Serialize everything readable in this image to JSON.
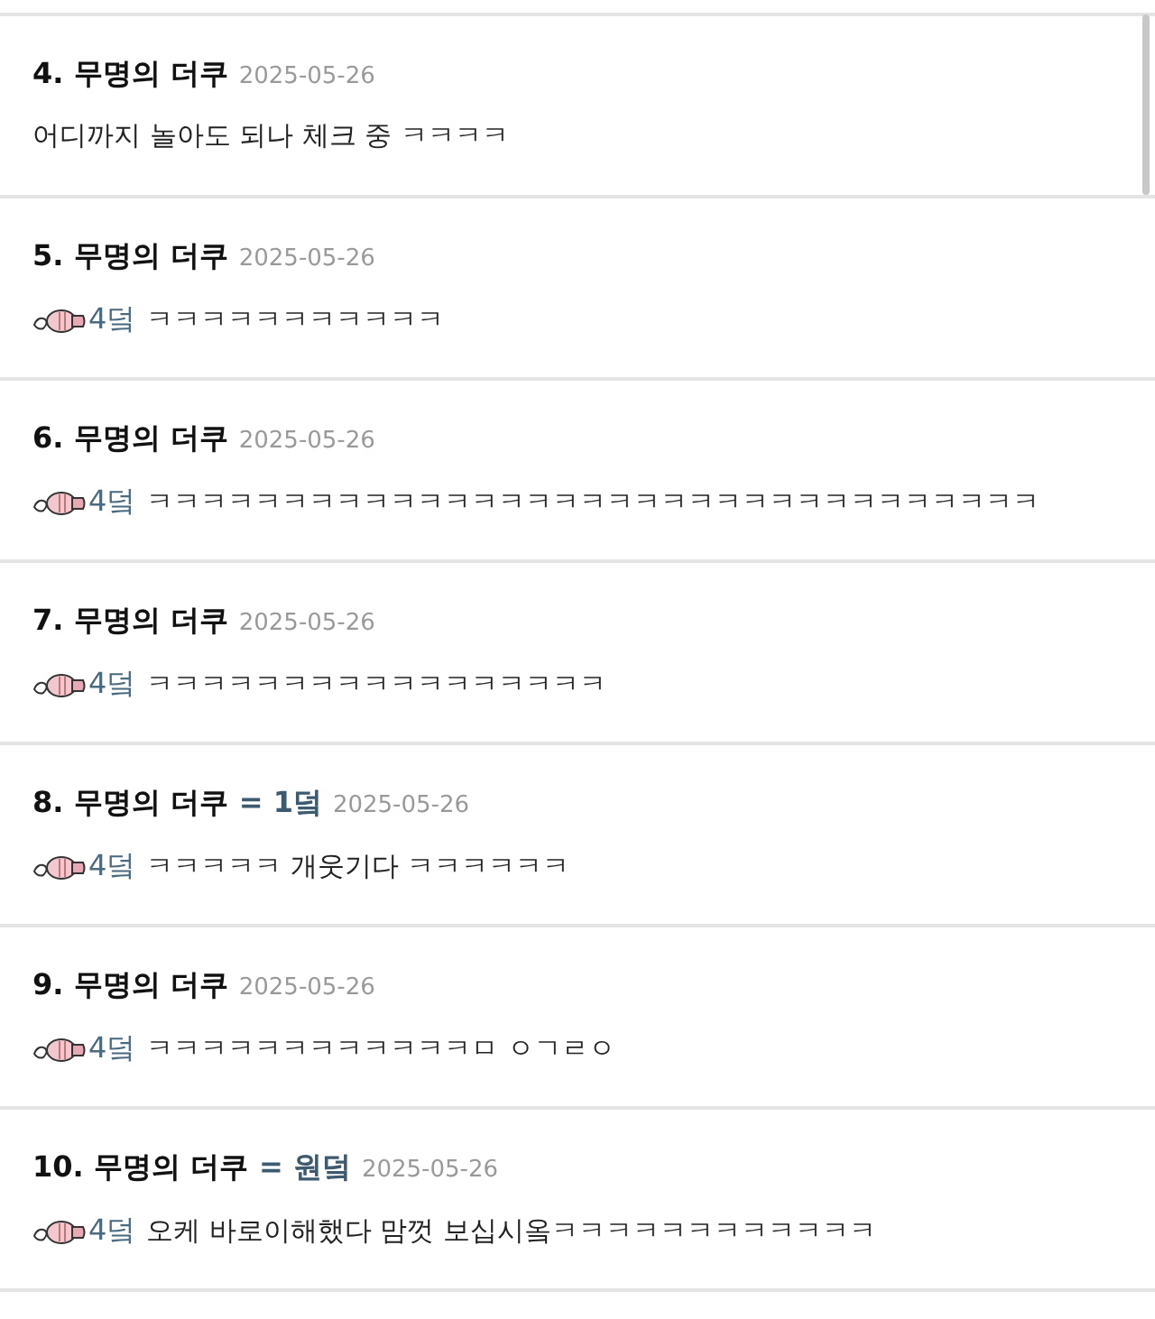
{
  "comments": [
    {
      "number": "4.",
      "author": "무명의 더쿠",
      "date": "2025-05-26",
      "body": "어디까지 놀아도 되나 체크 중 ㅋㅋㅋㅋ"
    },
    {
      "number": "5.",
      "author": "무명의 더쿠",
      "date": "2025-05-26",
      "reply_to": "4덬",
      "body": "ㅋㅋㅋㅋㅋㅋㅋㅋㅋㅋㅋ"
    },
    {
      "number": "6.",
      "author": "무명의 더쿠",
      "date": "2025-05-26",
      "reply_to": "4덬",
      "body": "ㅋㅋㅋㅋㅋㅋㅋㅋㅋㅋㅋㅋㅋㅋㅋㅋㅋㅋㅋㅋㅋㅋㅋㅋㅋㅋㅋㅋㅋㅋㅋㅋㅋ"
    },
    {
      "number": "7.",
      "author": "무명의 더쿠",
      "date": "2025-05-26",
      "reply_to": "4덬",
      "body": "ㅋㅋㅋㅋㅋㅋㅋㅋㅋㅋㅋㅋㅋㅋㅋㅋㅋ"
    },
    {
      "number": "8.",
      "author": "무명의 더쿠",
      "author_tag": "= 1덬",
      "date": "2025-05-26",
      "reply_to": "4덬",
      "body": "ㅋㅋㅋㅋㅋ 개웃기다 ㅋㅋㅋㅋㅋㅋ"
    },
    {
      "number": "9.",
      "author": "무명의 더쿠",
      "date": "2025-05-26",
      "reply_to": "4덬",
      "body": "ㅋㅋㅋㅋㅋㅋㅋㅋㅋㅋㅋㅋㅁ ㅇㄱㄹㅇ"
    },
    {
      "number": "10.",
      "author": "무명의 더쿠",
      "author_tag": "= 원덬",
      "date": "2025-05-26",
      "reply_to": "4덬",
      "body": "오케 바로이해했다 맘껏 보십시옼ㅋㅋㅋㅋㅋㅋㅋㅋㅋㅋㅋㅋ"
    }
  ]
}
